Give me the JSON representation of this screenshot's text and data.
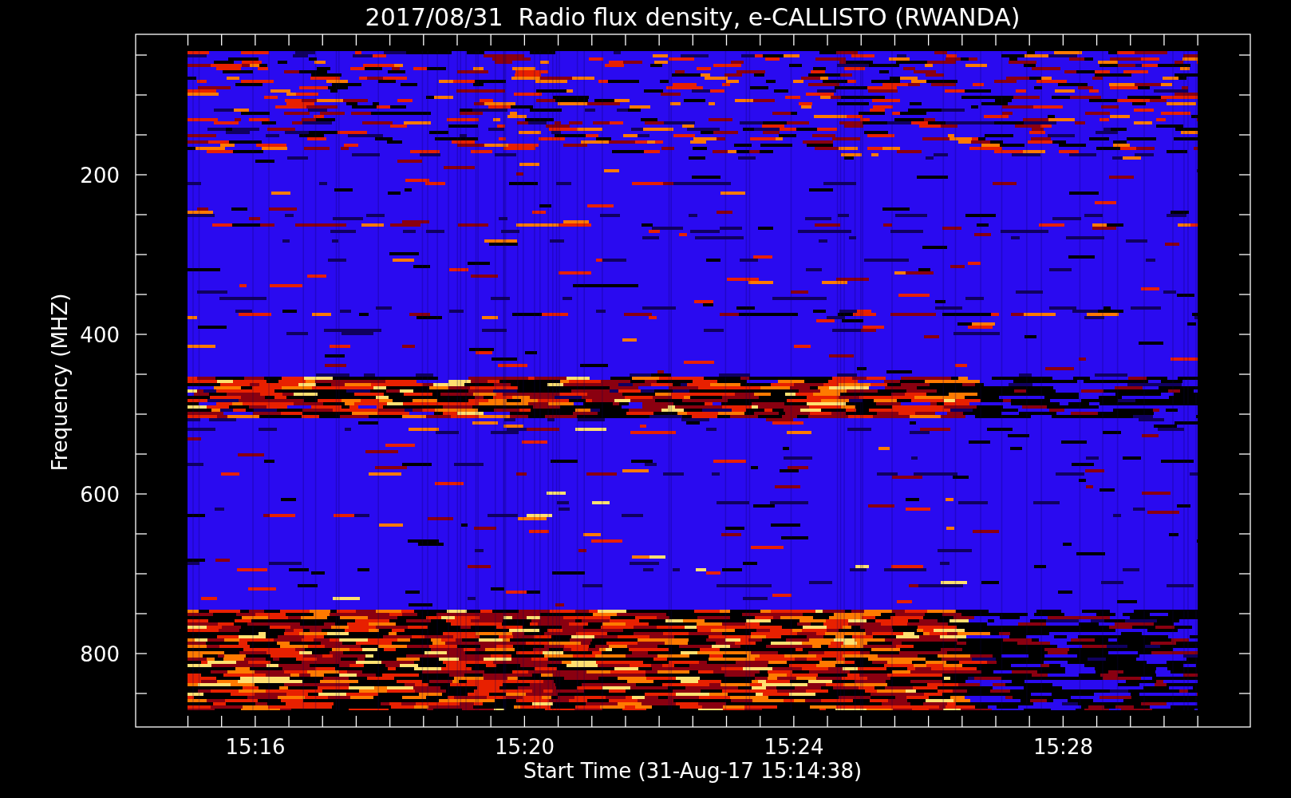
{
  "title": "2017/08/31  Radio flux density, e-CALLISTO (RWANDA)",
  "y_axis": {
    "label": "Frequency (MHZ)",
    "ticks": [
      "200",
      "400",
      "600",
      "800"
    ]
  },
  "x_axis": {
    "label": "Start Time (31-Aug-17 15:14:38)",
    "ticks": [
      "15:16",
      "15:20",
      "15:24",
      "15:28"
    ]
  }
}
